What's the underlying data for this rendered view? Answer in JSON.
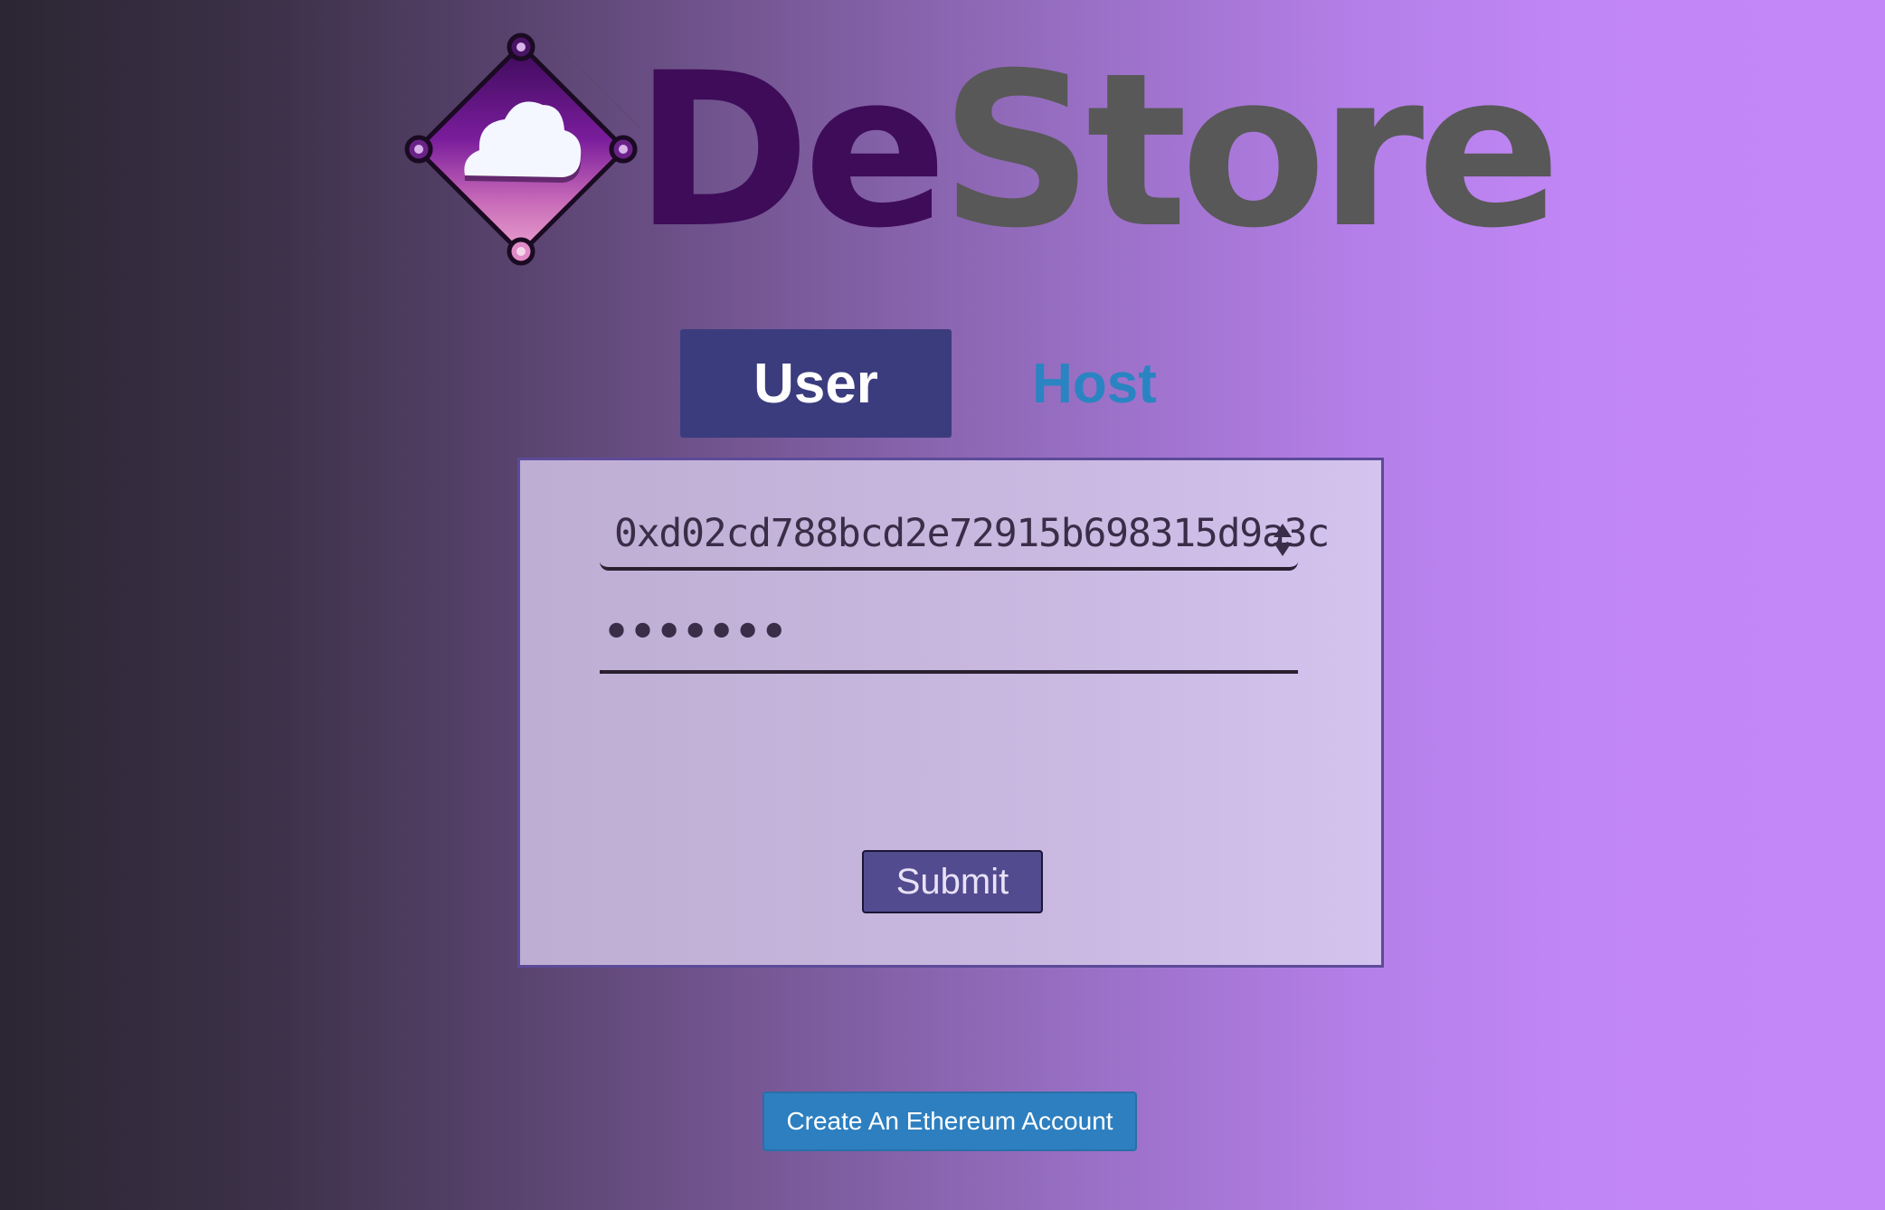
{
  "logo": {
    "word_part1": "De",
    "word_part2": "Store",
    "mark_icon": "cloud-diamond-icon"
  },
  "tabs": [
    {
      "label": "User",
      "active": true
    },
    {
      "label": "Host",
      "active": false
    }
  ],
  "login_form": {
    "account_select": {
      "selected_value": "0xd02cd788bcd2e72915b698315d9a3c",
      "icon": "select-arrows-icon"
    },
    "password": {
      "value": "•••••••"
    },
    "submit_label": "Submit"
  },
  "create_account_label": "Create An Ethereum Account",
  "colors": {
    "brand_dark_purple": "#3e0c59",
    "brand_gray": "#585858",
    "active_tab_bg": "#3b3c7e",
    "host_tab_text": "#2a84c2",
    "card_border": "#5c4a99",
    "submit_bg": "#534b8f",
    "create_button_bg": "#2d7fc0"
  }
}
